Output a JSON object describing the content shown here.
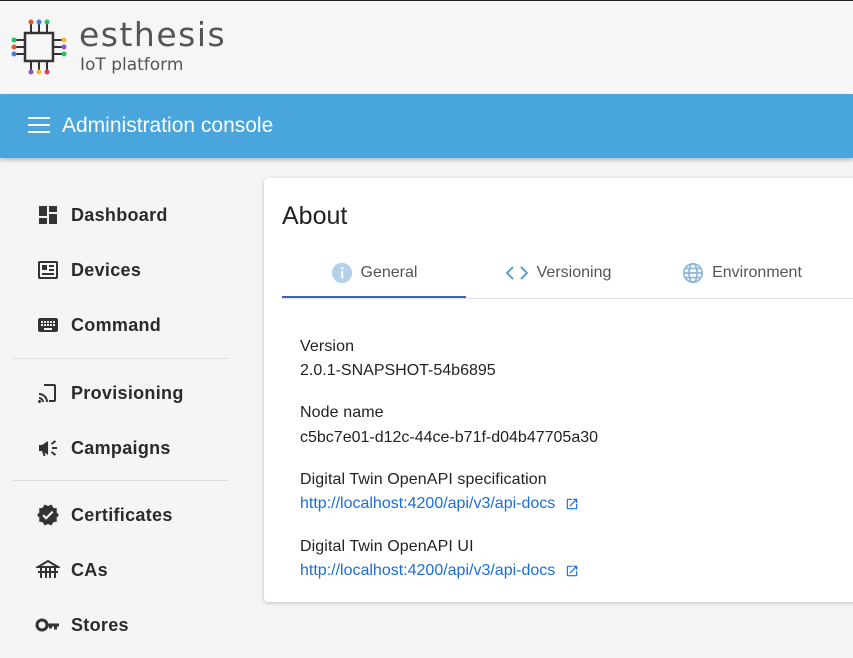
{
  "brand": {
    "name": "esthesis",
    "subtitle": "IoT platform"
  },
  "appbar": {
    "title": "Administration console"
  },
  "sidebar": {
    "items": [
      {
        "label": "Dashboard",
        "icon": "dashboard-icon"
      },
      {
        "label": "Devices",
        "icon": "devices-icon"
      },
      {
        "label": "Command",
        "icon": "keyboard-icon"
      },
      {
        "label": "Provisioning",
        "icon": "cast-icon"
      },
      {
        "label": "Campaigns",
        "icon": "megaphone-icon"
      },
      {
        "label": "Certificates",
        "icon": "verified-icon"
      },
      {
        "label": "CAs",
        "icon": "tower-icon"
      },
      {
        "label": "Stores",
        "icon": "key-icon"
      }
    ]
  },
  "about": {
    "title": "About",
    "tabs": [
      {
        "label": "General",
        "icon": "info-icon",
        "active": true
      },
      {
        "label": "Versioning",
        "icon": "code-icon",
        "active": false
      },
      {
        "label": "Environment",
        "icon": "globe-icon",
        "active": false
      }
    ],
    "fields": {
      "version_label": "Version",
      "version_value": "2.0.1-SNAPSHOT-54b6895",
      "node_label": "Node name",
      "node_value": "c5bc7e01-d12c-44ce-b71f-d04b47705a30",
      "spec_label": "Digital Twin OpenAPI specification",
      "spec_link": "http://localhost:4200/api/v3/api-docs",
      "ui_label": "Digital Twin OpenAPI UI",
      "ui_link": "http://localhost:4200/api/v3/api-docs"
    }
  },
  "colors": {
    "appbar": "#48a6dc",
    "link": "#1a6ed8",
    "tab_indicator": "#3f63b4"
  }
}
